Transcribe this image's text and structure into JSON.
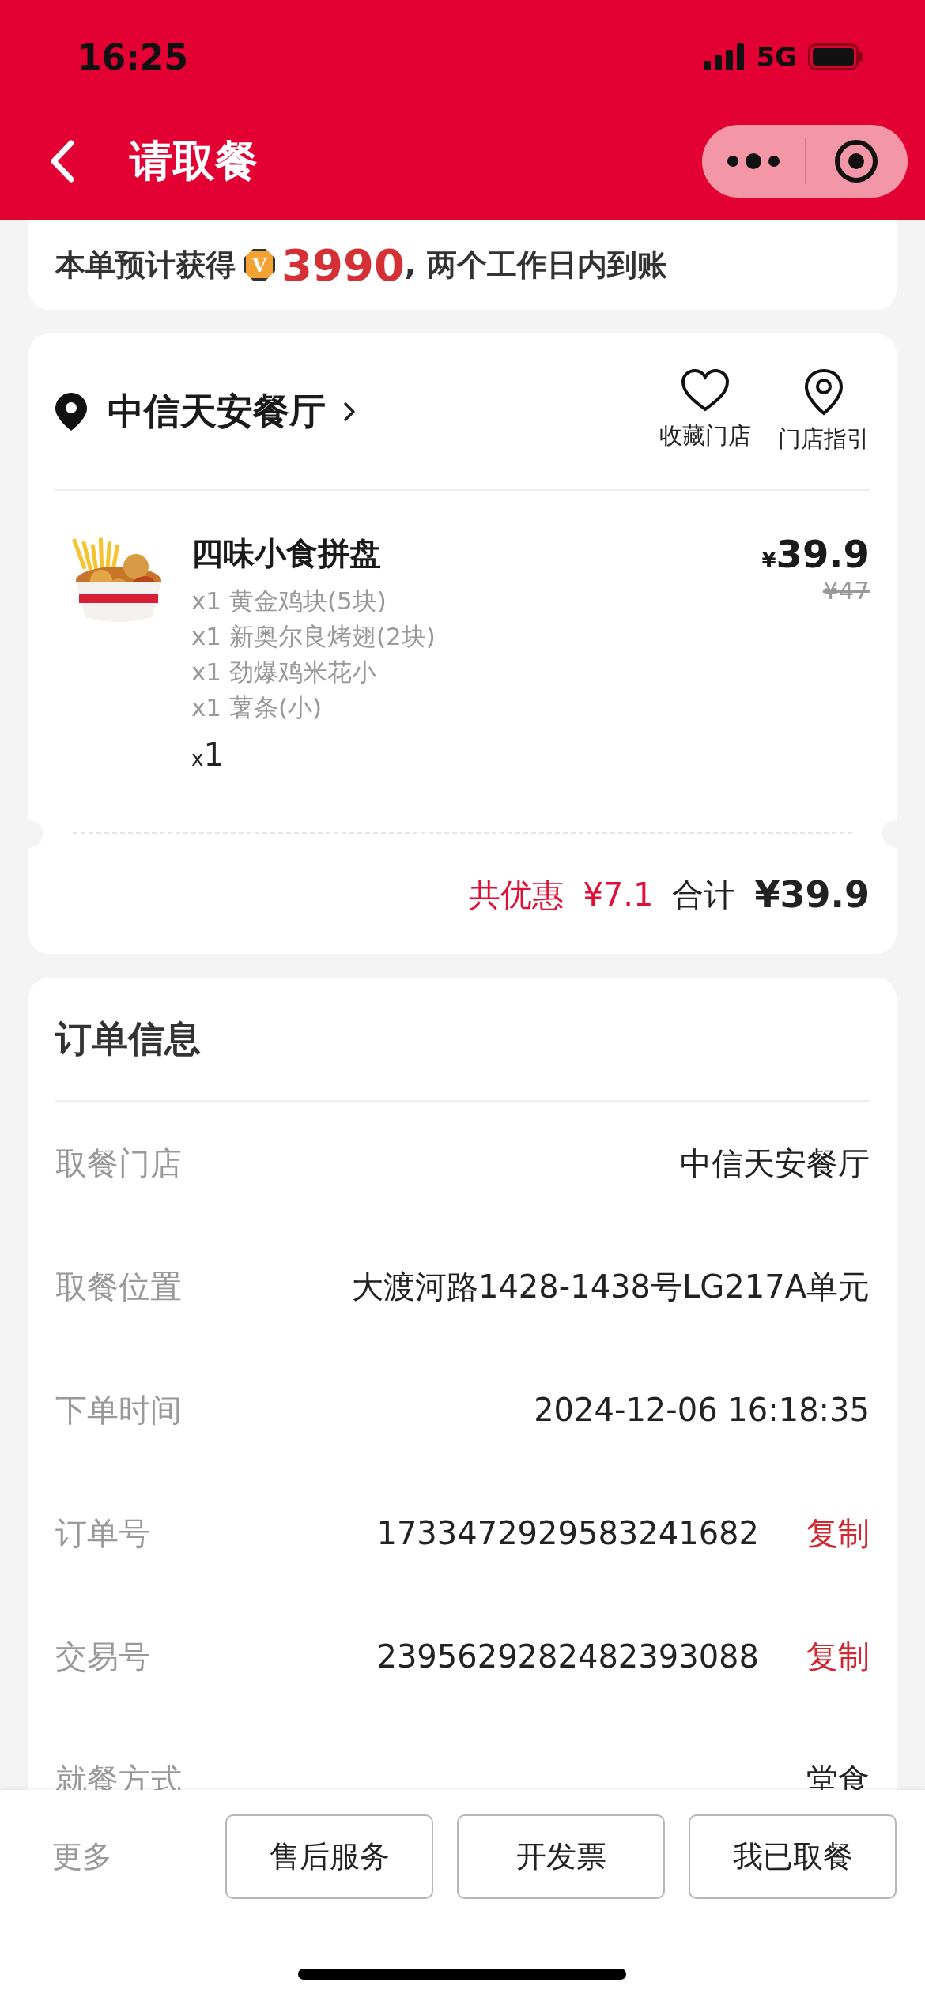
{
  "status_bar": {
    "time": "16:25",
    "network": "5G"
  },
  "nav": {
    "title": "请取餐"
  },
  "points_banner": {
    "prefix": "本单预计获得",
    "badge": "V",
    "points": "3990",
    "suffix": ", 两个工作日内到账"
  },
  "store": {
    "name": "中信天安餐厅",
    "actions": [
      {
        "label": "收藏门店",
        "kind": "heart"
      },
      {
        "label": "门店指引",
        "kind": "pin"
      }
    ]
  },
  "products": [
    {
      "name": "四味小食拼盘",
      "components": [
        "x1 黄金鸡块(5块)",
        "x1 新奥尔良烤翅(2块)",
        "x1 劲爆鸡米花小",
        "x1 薯条(小)"
      ],
      "quantity": "$_{x}$1",
      "price": "$_{¥}$39.9",
      "original_price": "¥47"
    }
  ],
  "summary": {
    "discount_label": "共优惠",
    "discount": "¥7.1",
    "total_label": "合计",
    "total": "¥39.9"
  },
  "order_info": {
    "title": "订单信息",
    "rows": [
      {
        "label": "取餐门店",
        "value": "中信天安餐厅"
      },
      {
        "label": "取餐位置",
        "value": "大渡河路1428-1438号LG217A单元"
      },
      {
        "label": "下单时间",
        "value": "2024-12-06 16:18:35"
      },
      {
        "label": "订单号",
        "value": "1733472929583241682",
        "action": "复制"
      },
      {
        "label": "交易号",
        "value": "2395629282482393088",
        "action": "复制"
      },
      {
        "label": "就餐方式",
        "value": "堂食"
      }
    ]
  },
  "bottom_bar": {
    "more": "更多",
    "buttons": [
      "售后服务",
      "开发票",
      "我已取餐"
    ]
  }
}
